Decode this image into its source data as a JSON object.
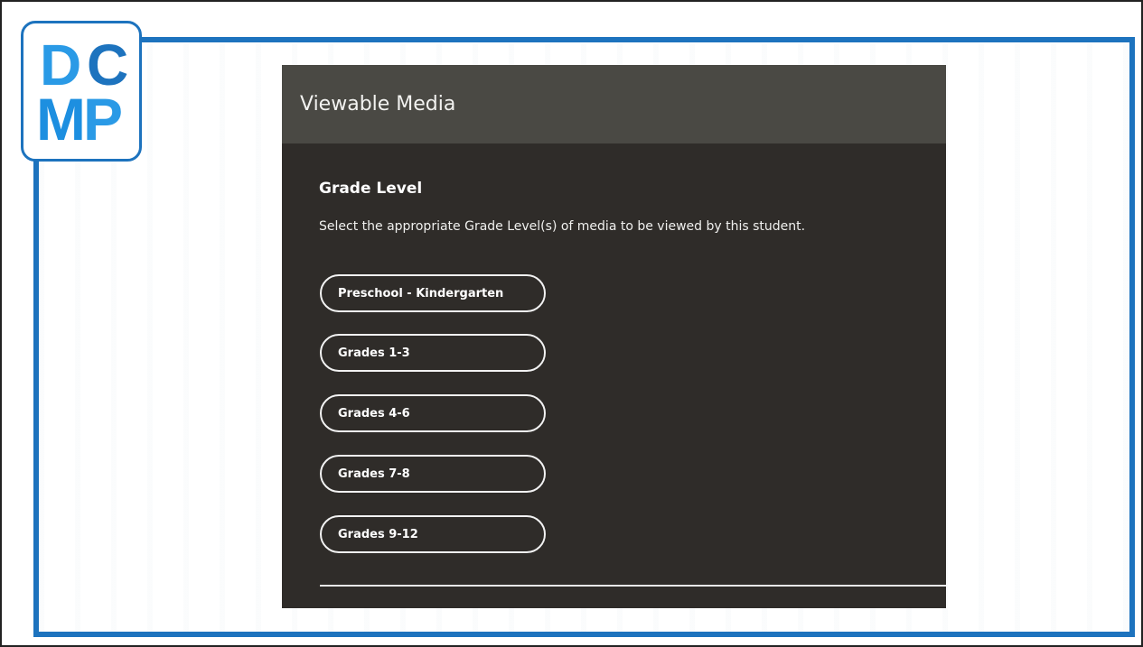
{
  "logo": {
    "letters": [
      "D",
      "C",
      "M",
      "P"
    ],
    "colors": {
      "primary": "#1d73be",
      "secondary": "#2a9ae6"
    }
  },
  "panel": {
    "title": "Viewable Media",
    "section_title": "Grade Level",
    "description": "Select the appropriate Grade Level(s) of media to be viewed by this student.",
    "options": [
      "Preschool - Kindergarten",
      "Grades 1-3",
      "Grades 4-6",
      "Grades 7-8",
      "Grades 9-12"
    ]
  },
  "colors": {
    "frame": "#1d73be",
    "panel_bg": "#2f2c29",
    "header_bg": "#4a4944"
  }
}
